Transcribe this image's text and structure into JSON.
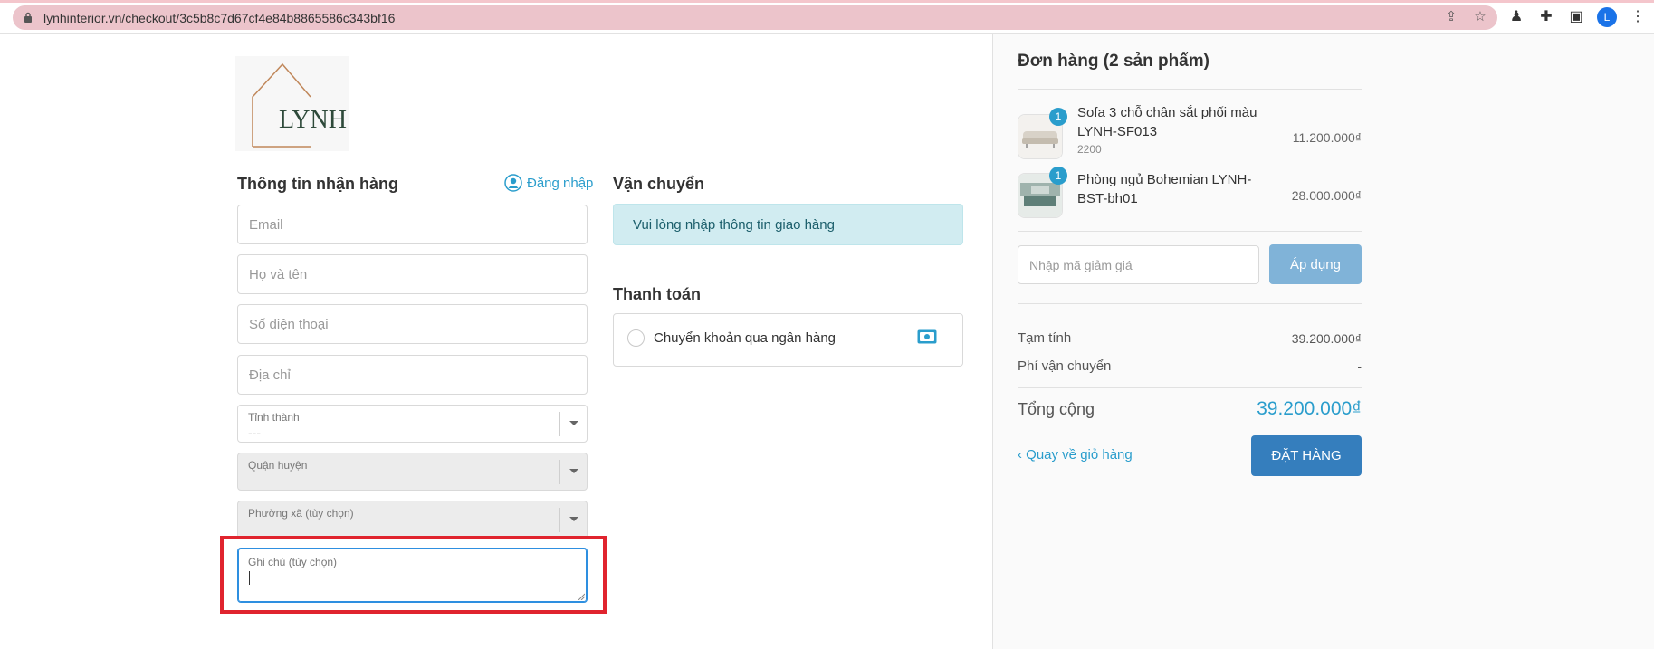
{
  "browser": {
    "url": "lynhinterior.vn/checkout/3c5b8c7d67cf4e84b8865586c343bf16",
    "avatar_letter": "L"
  },
  "logo": {
    "text": "LYNH"
  },
  "receiver": {
    "title": "Thông tin nhận hàng",
    "login_label": "Đăng nhập",
    "email_placeholder": "Email",
    "name_placeholder": "Họ và tên",
    "phone_placeholder": "Số điện thoại",
    "address_placeholder": "Địa chỉ",
    "province_label": "Tỉnh thành",
    "province_value": "---",
    "district_label": "Quận huyện",
    "ward_label": "Phường xã (tùy chọn)",
    "note_label": "Ghi chú (tùy chọn)"
  },
  "shipping": {
    "title": "Vận chuyển",
    "info": "Vui lòng nhập thông tin giao hàng"
  },
  "payment": {
    "title": "Thanh toán",
    "option": "Chuyển khoản qua ngân hàng"
  },
  "order": {
    "title": "Đơn hàng (2 sản phẩm)",
    "items": [
      {
        "qty": "1",
        "name": "Sofa 3 chỗ chân sắt phối màu LYNH-SF013",
        "sub": "2200",
        "price": "11.200.000₫"
      },
      {
        "qty": "1",
        "name": "Phòng ngủ Bohemian LYNH-BST-bh01",
        "sub": "",
        "price": "28.000.000₫"
      }
    ],
    "coupon_placeholder": "Nhập mã giảm giá",
    "apply_label": "Áp dụng",
    "subtotal_label": "Tạm tính",
    "subtotal_value": "39.200.000₫",
    "shipping_fee_label": "Phí vận chuyển",
    "shipping_fee_value": "-",
    "total_label": "Tổng cộng",
    "total_value": "39.200.000₫",
    "back_label": "‹ Quay về giỏ hàng",
    "submit_label": "ĐẶT HÀNG"
  }
}
